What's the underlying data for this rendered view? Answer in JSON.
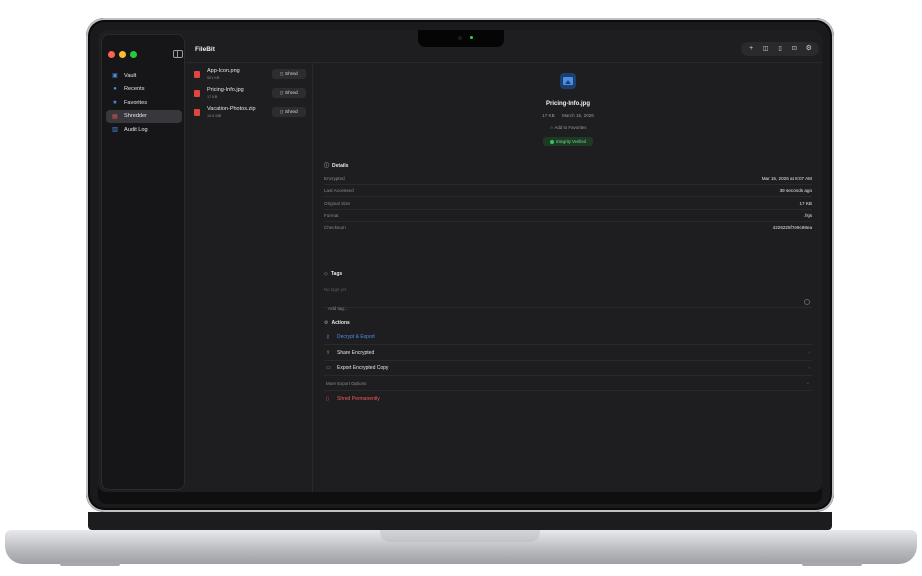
{
  "app": {
    "title": "FileBit"
  },
  "sidebar": {
    "items": [
      {
        "label": "Vault",
        "icon": "lock-icon",
        "color": "#4c8fe6"
      },
      {
        "label": "Recents",
        "icon": "clock-icon",
        "color": "#4c8fe6"
      },
      {
        "label": "Favorites",
        "icon": "star-icon",
        "color": "#4c8fe6"
      },
      {
        "label": "Shredder",
        "icon": "shredder-icon",
        "color": "#ef5b57",
        "active": true
      },
      {
        "label": "Audit Log",
        "icon": "document-icon",
        "color": "#4c8fe6"
      }
    ]
  },
  "toolbar": {
    "buttons": [
      {
        "name": "add",
        "glyph": "+"
      },
      {
        "name": "unlock",
        "glyph": "🔓"
      },
      {
        "name": "trash",
        "glyph": "🗑"
      },
      {
        "name": "lock",
        "glyph": "🔒"
      },
      {
        "name": "settings",
        "glyph": "⚙"
      }
    ]
  },
  "files": [
    {
      "name": "App-Icon.png",
      "size": "501 KB",
      "shred_label": "Shred"
    },
    {
      "name": "Pricing-Info.jpg",
      "size": "17 KB",
      "shred_label": "Shred"
    },
    {
      "name": "Vacation-Photos.zip",
      "size": "19.6 MB",
      "shred_label": "Shred"
    }
  ],
  "detail": {
    "file_name": "Pricing-Info.jpg",
    "size": "17 KB",
    "date": "March 15, 2026",
    "favorite_label": "Add to Favorites",
    "integrity": "Integrity Verified",
    "details_title": "Details",
    "details": [
      {
        "key": "Encrypted",
        "value": "Mar 15, 2026 at 8:07 AM"
      },
      {
        "key": "Last Accessed",
        "value": "39 seconds ago"
      },
      {
        "key": "Original Size",
        "value": "17 KB"
      },
      {
        "key": "Format",
        "value": ".fsjs"
      },
      {
        "key": "Checksum",
        "value": "4226225f7e9c98ea"
      }
    ],
    "tags_title": "Tags",
    "no_tags": "No tags yet",
    "tag_placeholder": "Add tag...",
    "actions_title": "Actions",
    "actions": {
      "decrypt": "Decrypt & Export",
      "share": "Share Encrypted",
      "export_copy": "Export Encrypted Copy",
      "more": "More Export Options",
      "shred": "Shred Permanently"
    }
  }
}
